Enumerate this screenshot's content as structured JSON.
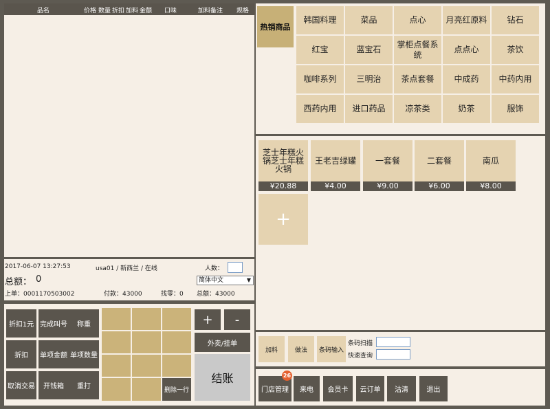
{
  "order_table": {
    "headers": [
      "品名",
      "价格",
      "数量",
      "折扣",
      "加料",
      "金额",
      "口味",
      "加料备注",
      "规格"
    ]
  },
  "info": {
    "datetime": "2017-06-07 13:27:53",
    "user_status": "usa01 / 新西兰 / 在线",
    "persons_label": "人数：",
    "total_label": "总额：",
    "total_value": "0",
    "language": "简体中文",
    "last_order": "上单：0001170503002",
    "paid": "付款：43000",
    "change": "找零：0",
    "sum": "总额：43000"
  },
  "keypad": {
    "buttons": [
      {
        "label": "折扣1元"
      },
      {
        "label": "完成叫号"
      },
      {
        "label": "称重"
      },
      {
        "label": "折扣"
      },
      {
        "label": "单项金额"
      },
      {
        "label": "单项数量"
      },
      {
        "label": "取消交易"
      },
      {
        "label": "开钱箱"
      },
      {
        "label": "重打"
      }
    ],
    "delete_row": "删除一行",
    "plus": "+",
    "minus": "-",
    "takeout": "外卖/挂单",
    "checkout": "结账"
  },
  "categories": {
    "hot": "热销商品",
    "items": [
      "韩国料理",
      "菜品",
      "点心",
      "月亮红原料",
      "钻石",
      "红宝",
      "蓝宝石",
      "掌柜点餐系统",
      "点点心",
      "茶饮",
      "咖啡系列",
      "三明治",
      "茶点套餐",
      "中成药",
      "中药内用",
      "西药内用",
      "进口药品",
      "凉茶类",
      "奶茶",
      "服饰"
    ]
  },
  "products": [
    {
      "name": "芝士年糕火锅芝士年糕火锅",
      "price": "¥20.88"
    },
    {
      "name": "王老吉绿罐",
      "price": "¥4.00"
    },
    {
      "name": "一套餐",
      "price": "¥9.00"
    },
    {
      "name": "二套餐",
      "price": "¥6.00"
    },
    {
      "name": "南瓜",
      "price": "¥8.00"
    }
  ],
  "add_product": "+",
  "options": {
    "add_on": "加料",
    "method": "做法",
    "barcode_input": "条码输入",
    "barcode_scan": "条码扫描",
    "quick_search": "快速查询"
  },
  "functions": {
    "store_manage": "门店管理",
    "badge": "26",
    "incoming_call": "来电",
    "member_card": "会员卡",
    "cloud_order": "云订单",
    "clear": "沽清",
    "exit": "退出"
  },
  "colors": {
    "dark": "#5a554d",
    "tile": "#e5d3b1",
    "accent": "#cbb37a",
    "panel": "#f6efe6",
    "badge": "#e5602e"
  }
}
